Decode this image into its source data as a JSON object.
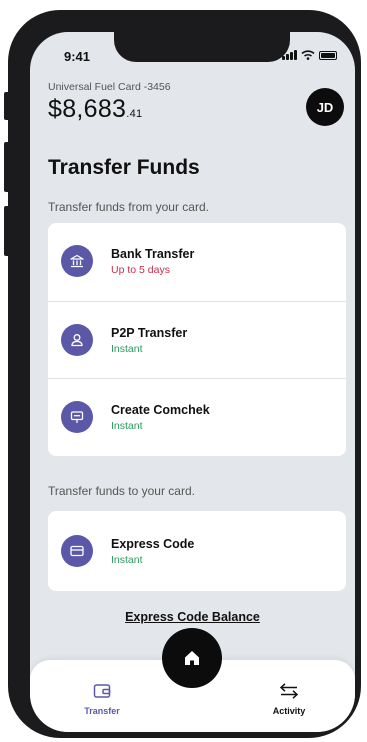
{
  "status_bar": {
    "time": "9:41"
  },
  "account": {
    "card_name": "Universal Fuel Card -3456",
    "balance_main": "$8,683",
    "balance_cents": ".41",
    "avatar_initials": "JD"
  },
  "page": {
    "title": "Transfer Funds",
    "from_card_label": "Transfer funds from your card.",
    "to_card_label": "Transfer funds to your card."
  },
  "transfer_from": [
    {
      "title": "Bank Transfer",
      "subtitle": "Up to 5 days",
      "icon": "bank-icon"
    },
    {
      "title": "P2P Transfer",
      "subtitle": "Instant",
      "icon": "person-icon"
    },
    {
      "title": "Create Comchek",
      "subtitle": "Instant",
      "icon": "check-icon"
    }
  ],
  "transfer_to": [
    {
      "title": "Express Code",
      "subtitle": "Instant",
      "icon": "card-icon"
    }
  ],
  "express_code_balance_link": "Express Code Balance",
  "tab_bar": {
    "transfer_label": "Transfer",
    "activity_label": "Activity",
    "home_icon": "home-icon"
  },
  "colors": {
    "accent": "#5b58a8",
    "status_slow": "#c5304b",
    "status_instant": "#2c9a5e",
    "screen_background": "#e3e6ea"
  }
}
